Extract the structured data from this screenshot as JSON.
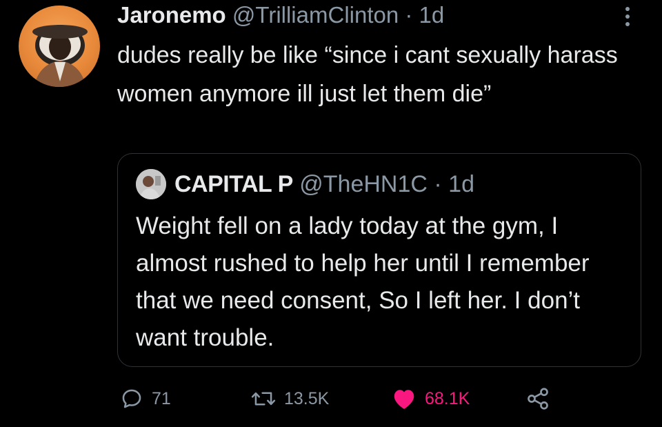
{
  "tweet": {
    "author_name": "Jaronemo",
    "author_handle": "@TrilliamClinton",
    "separator": "·",
    "time": "1d",
    "text": "dudes really be like “since i cant sexually harass women anymore ill just let them die”"
  },
  "quote": {
    "author_name": "CAPITAL P",
    "author_handle": "@TheHN1C",
    "separator": "·",
    "time": "1d",
    "text": "Weight fell on a lady today at the gym, I almost rushed to help her until I remember that we need consent, So I left her. I don’t want trouble."
  },
  "actions": {
    "replies": "71",
    "retweets": "13.5K",
    "likes": "68.1K"
  },
  "icons": {
    "more": "more-vertical-icon",
    "reply": "reply-icon",
    "retweet": "retweet-icon",
    "like": "heart-filled-icon",
    "share": "share-icon"
  },
  "colors": {
    "background": "#000000",
    "text": "#e7e9ea",
    "secondary": "#8b98a5",
    "like": "#f91880",
    "border": "#2f3336"
  }
}
